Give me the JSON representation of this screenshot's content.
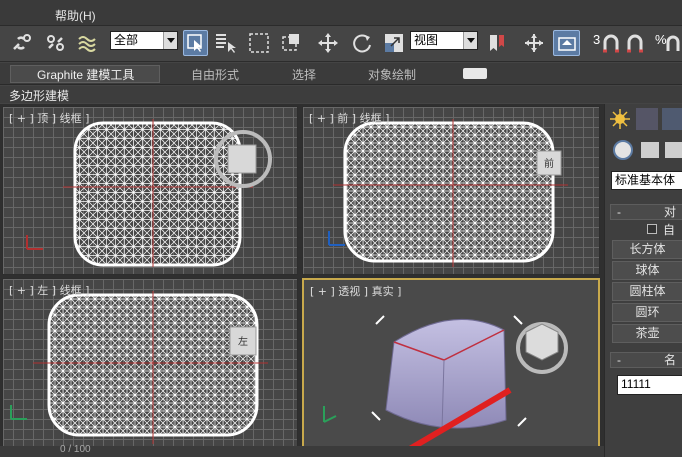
{
  "menu": {
    "help": "帮助(H)"
  },
  "toolbar": {
    "selection_filter": "全部",
    "reference_coord": "视图",
    "snap_label": "3",
    "percent_symbol": "%"
  },
  "ribbon": {
    "tabs": [
      "Graphite 建模工具",
      "自由形式",
      "选择",
      "对象绘制"
    ],
    "subpanel": "多边形建模"
  },
  "viewports": {
    "top": "[ + ] 顶 ] 线框 ]",
    "front": "[ + ] 前 ] 线框 ]",
    "left": "[ + ] 左 ] 线框 ]",
    "perspective": "[ + ] 透视 ] 真实 ]",
    "front_cube": "前",
    "left_cube": "左"
  },
  "command_panel": {
    "category_dropdown": "标准基本体",
    "rollout_object_type": "对",
    "autogrid": "自",
    "buttons": [
      "长方体",
      "球体",
      "圆柱体",
      "圆环",
      "茶壶"
    ],
    "rollout_name": "名",
    "name_value": "11111"
  },
  "status": {
    "frame_counter": "0 / 100"
  },
  "colors": {
    "active_viewport_border": "#c8a94c",
    "wire": "#ffffff",
    "perspective_object": "#9c97c3",
    "arrow": "#e02020"
  }
}
